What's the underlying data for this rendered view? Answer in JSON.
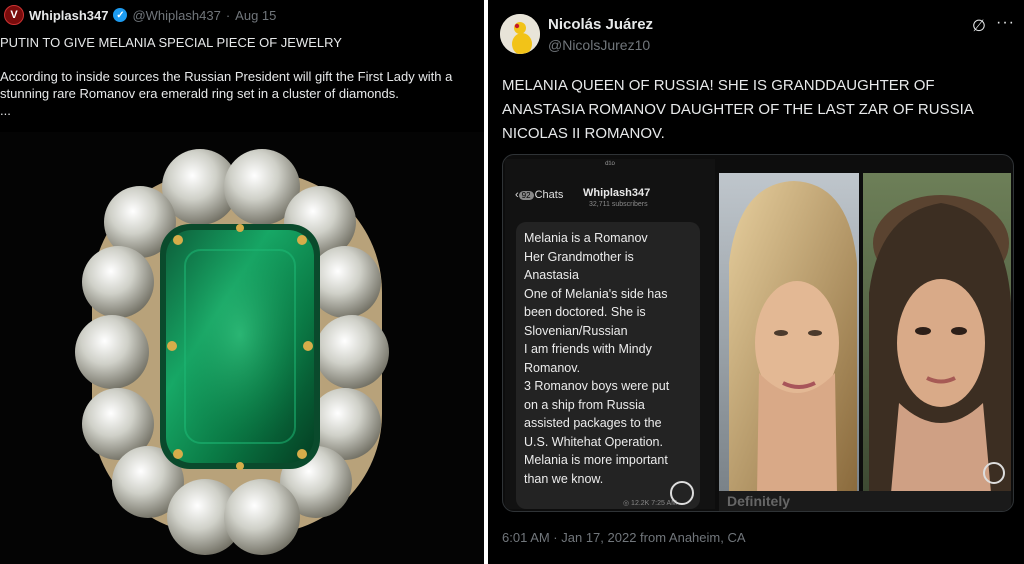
{
  "left_tweet": {
    "avatar_letter": "V",
    "display_name": "Whiplash347",
    "handle": "@Whiplash437",
    "separator": "·",
    "date": "Aug 15",
    "headline": "PUTIN TO GIVE MELANIA SPECIAL PIECE OF JEWELRY",
    "body_line1": "According to inside sources the Russian President will gift the First Lady with a",
    "body_line2": "stunning rare Romanov era emerald ring set in a cluster of diamonds.",
    "ellipsis": "...",
    "image_icon": "emerald-ring-image"
  },
  "right_tweet": {
    "display_name": "Nicolás Juárez",
    "handle": "@NicolsJurez10",
    "text": "MELANIA QUEEN OF RUSSIA! SHE IS GRANDDAUGHTER OF ANASTASIA ROMANOV DAUGHTER OF THE LAST ZAR OF RUSSIA NICOLAS II ROMANOV.",
    "grok_icon": "∅",
    "more_icon": "···",
    "meta": "6:01 AM · Jan 17, 2022 from Anaheim, CA",
    "media": {
      "phone_status": "ᵈ¹ᵒ",
      "back_label": "Chats",
      "badge_count": "92",
      "channel_title": "Whiplash347",
      "subscribers": "32,711 subscribers",
      "message_lines": [
        "Melania is a Romanov",
        "Her Grandmother is",
        "Anastasia",
        "One of Melania's side has",
        "been doctored. She is",
        "Slovenian/Russian",
        "I am friends with Mindy",
        "Romanov.",
        "3 Romanov boys were put",
        "on a ship from Russia",
        "assisted packages to the",
        "U.S. Whitehat Operation.",
        "Melania is more important",
        "than we know."
      ],
      "message_meta": "◎ 12.2K 7:25 AM",
      "caption_fragment": "Definitely"
    }
  },
  "colors": {
    "background": "#000000",
    "text": "#e7e9ea",
    "muted": "#71767b",
    "verified": "#1d9bf0",
    "emerald": "#0a8a4a"
  }
}
